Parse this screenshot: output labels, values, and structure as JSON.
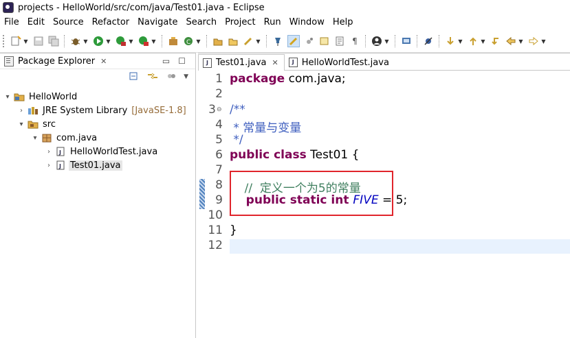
{
  "window": {
    "title": "projects - HelloWorld/src/com/java/Test01.java - Eclipse"
  },
  "menu": [
    "File",
    "Edit",
    "Source",
    "Refactor",
    "Navigate",
    "Search",
    "Project",
    "Run",
    "Window",
    "Help"
  ],
  "package_explorer": {
    "title": "Package Explorer",
    "tree": {
      "project": "HelloWorld",
      "jre": "JRE System Library",
      "jre_decorator": "[JavaSE-1.8]",
      "src": "src",
      "package": "com.java",
      "file1": "HelloWorldTest.java",
      "file2": "Test01.java"
    }
  },
  "editor": {
    "tabs": [
      "Test01.java",
      "HelloWorldTest.java"
    ],
    "line_numbers": [
      "1",
      "2",
      "3",
      "4",
      "5",
      "6",
      "7",
      "8",
      "9",
      "10",
      "11",
      "12"
    ],
    "code": {
      "l1_kw": "package",
      "l1_rest": " com.java;",
      "l3": "/**",
      "l4": " * 常量与变量",
      "l5": " */",
      "l6_kw": "public class",
      "l6_rest": " Test01 {",
      "l8": "    //  定义一个为5的常量",
      "l9_kw": "    public static int ",
      "l9_const": "FIVE",
      "l9_rest": " = 5;",
      "l11": "}"
    }
  },
  "colors": {
    "keyword": "#7f0055",
    "javadoc": "#3f5fbf",
    "comment": "#3f7f5f",
    "constant": "#0000c0",
    "highlight_box": "#e0242b"
  }
}
